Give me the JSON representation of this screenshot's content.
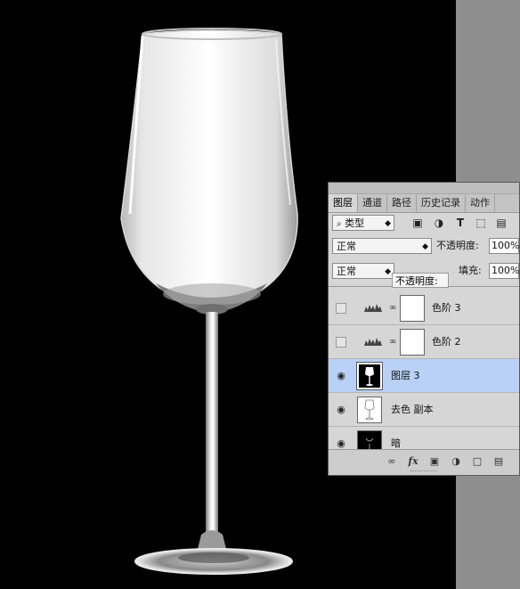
{
  "tabs": [
    "图层",
    "通道",
    "路径",
    "历史记录",
    "动作"
  ],
  "filter": {
    "kind_label": "类型"
  },
  "blend": {
    "mode": "正常",
    "opacity_label": "不透明度:",
    "opacity_value": "100%"
  },
  "row2": {
    "mode_partial": "正常",
    "fill_label": "填充:",
    "fill_value": "100%"
  },
  "tooltip": "不透明度:",
  "layers": [
    {
      "name": "色阶 3",
      "visible": false
    },
    {
      "name": "色阶 2",
      "visible": false
    },
    {
      "name": "图层 3",
      "visible": true,
      "selected": true
    },
    {
      "name": "去色 副本",
      "visible": true
    },
    {
      "name": "暗",
      "visible": true
    }
  ],
  "icons": {
    "search": "search-icon",
    "image_filter": "image-filter-icon",
    "adjust_filter": "adjustment-filter-icon",
    "type_filter": "type-filter-icon",
    "shape_filter": "shape-filter-icon",
    "smart_filter": "smart-object-filter-icon",
    "eye": "eye-icon",
    "link": "link-icon",
    "fx": "fx-icon",
    "mask": "mask-icon",
    "new_adjust": "adjustment-layer-icon",
    "group": "folder-icon",
    "new_layer": "new-layer-icon"
  },
  "colors": {
    "selected_row": "#b9d1f6",
    "panel_bg": "#d6d6d6",
    "pasteboard": "#8e8e8e"
  }
}
